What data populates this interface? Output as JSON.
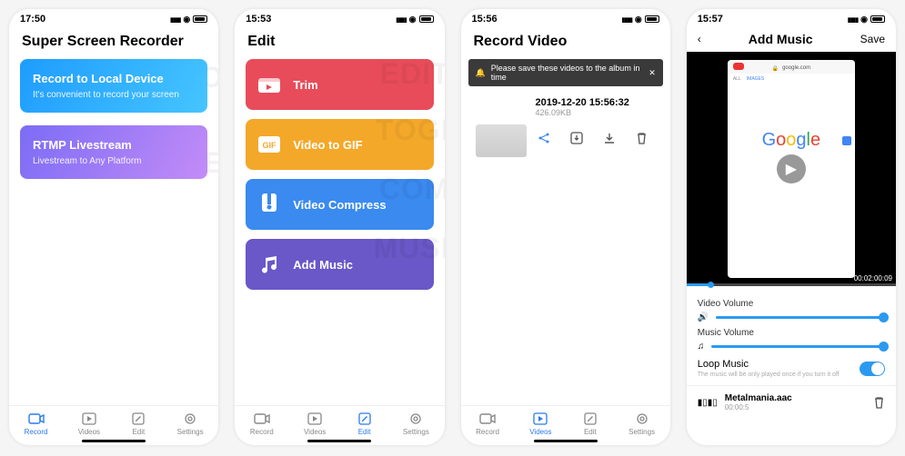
{
  "screen1": {
    "time": "17:50",
    "title": "Super Screen Recorder",
    "watermark1": "RECO",
    "watermark2": "LIVE",
    "card1": {
      "title": "Record to Local Device",
      "sub": "It's convenient to record your screen"
    },
    "card2": {
      "title": "RTMP Livestream",
      "sub": "Livestream to Any Platform"
    },
    "tabs": [
      "Record",
      "Videos",
      "Edit",
      "Settings"
    ]
  },
  "screen2": {
    "time": "15:53",
    "title": "Edit",
    "watermarks": [
      "EDIT",
      "TOGI",
      "COM",
      "MUSI"
    ],
    "items": [
      {
        "label": "Trim"
      },
      {
        "label": "Video to GIF"
      },
      {
        "label": "Video Compress"
      },
      {
        "label": "Add Music"
      }
    ],
    "tabs": [
      "Record",
      "Videos",
      "Edit",
      "Settings"
    ]
  },
  "screen3": {
    "time": "15:56",
    "title": "Record Video",
    "banner": "Please save these videos to the album in time",
    "video": {
      "title": "2019-12-20 15:56:32",
      "size": "426.09KB"
    },
    "tabs": [
      "Record",
      "Videos",
      "Edit",
      "Settings"
    ]
  },
  "screen4": {
    "time": "15:57",
    "nav": {
      "title": "Add Music",
      "save": "Save"
    },
    "url": "google.com",
    "google": "Google",
    "tabs_mini": [
      "ALL",
      "IMAGES"
    ],
    "duration": "00:02:00:09",
    "videoVolume": "Video Volume",
    "musicVolume": "Music Volume",
    "loopLabel": "Loop Music",
    "loopDesc": "The music will be only played once if you turn it off",
    "track": {
      "name": "Metalmania.aac",
      "time": "00:00:5"
    }
  }
}
